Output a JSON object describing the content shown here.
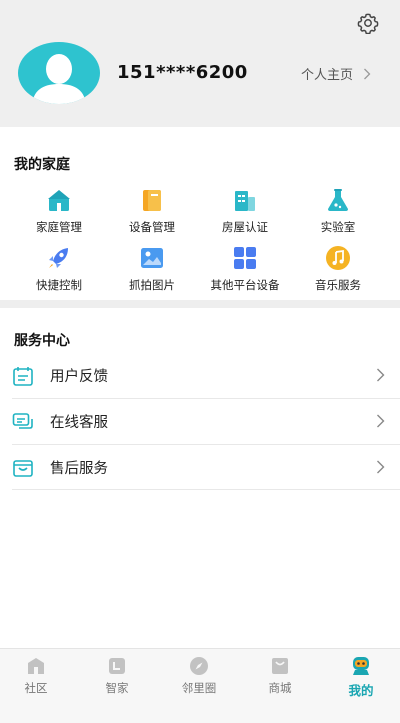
{
  "header": {
    "phone": "151****6200",
    "profile_link": "个人主页",
    "icons": {
      "settings": "gear-icon",
      "avatar": "user-avatar",
      "chevron": "chevron-right-icon"
    }
  },
  "family": {
    "title": "我的家庭",
    "items": [
      {
        "label": "家庭管理",
        "icon": "house-icon",
        "color": "#2ab7c8"
      },
      {
        "label": "设备管理",
        "icon": "devices-icon",
        "color": "#f5a623"
      },
      {
        "label": "房屋认证",
        "icon": "building-icon",
        "color": "#2ab7c8"
      },
      {
        "label": "实验室",
        "icon": "flask-icon",
        "color": "#2ab7c8"
      },
      {
        "label": "快捷控制",
        "icon": "rocket-icon",
        "color": "#4a7cf0"
      },
      {
        "label": "抓拍图片",
        "icon": "image-icon",
        "color": "#4a9af0"
      },
      {
        "label": "其他平台设备",
        "icon": "apps-grid-icon",
        "color": "#4a7cf0"
      },
      {
        "label": "音乐服务",
        "icon": "music-icon",
        "color": "#f5b323"
      }
    ]
  },
  "services": {
    "title": "服务中心",
    "items": [
      {
        "label": "用户反馈",
        "icon": "calendar-feedback-icon"
      },
      {
        "label": "在线客服",
        "icon": "chat-icon"
      },
      {
        "label": "售后服务",
        "icon": "package-icon"
      }
    ],
    "accent": "#1fb3c2"
  },
  "tabs": [
    {
      "label": "社区",
      "icon": "community-icon"
    },
    {
      "label": "智家",
      "icon": "smart-home-icon"
    },
    {
      "label": "邻里圈",
      "icon": "compass-icon"
    },
    {
      "label": "商城",
      "icon": "mall-icon"
    },
    {
      "label": "我的",
      "icon": "me-icon",
      "active": true
    }
  ],
  "colors": {
    "accent": "#1aa6b2",
    "header_bg": "#efefef"
  }
}
